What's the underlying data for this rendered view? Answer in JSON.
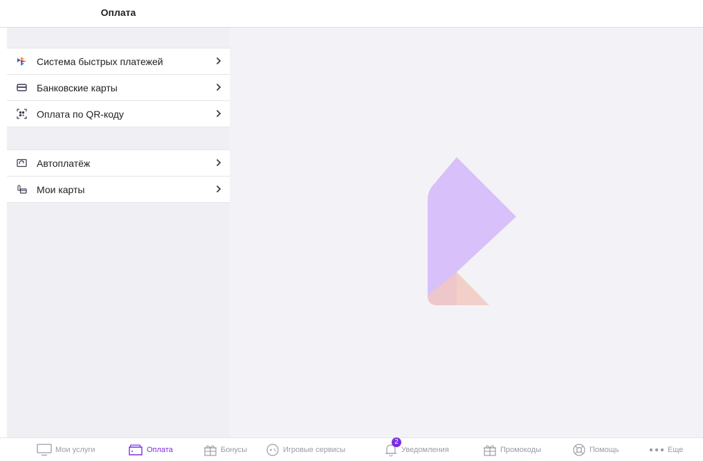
{
  "header": {
    "title": "Оплата"
  },
  "sidebar": {
    "group1": [
      {
        "label": "Система быстрых платежей",
        "icon": "sbp-icon"
      },
      {
        "label": "Банковские карты",
        "icon": "bank-card-icon"
      },
      {
        "label": "Оплата по QR-коду",
        "icon": "qr-code-icon"
      }
    ],
    "group2": [
      {
        "label": "Автоплатёж",
        "icon": "autopay-icon"
      },
      {
        "label": "Мои карты",
        "icon": "my-cards-icon"
      }
    ]
  },
  "tabbar": {
    "items": [
      {
        "label": "Мои услуги",
        "icon": "monitor-icon"
      },
      {
        "label": "Оплата",
        "icon": "wallet-icon",
        "active": true
      },
      {
        "label": "Бонусы",
        "icon": "gift-icon"
      },
      {
        "label": "Игровые сервисы",
        "icon": "gamepad-icon"
      },
      {
        "label": "Уведомления",
        "icon": "bell-icon",
        "badge": "2"
      },
      {
        "label": "Промокоды",
        "icon": "promo-gift-icon"
      },
      {
        "label": "Помощь",
        "icon": "lifebuoy-icon"
      },
      {
        "label": "Еще",
        "icon": "more-dots-icon"
      }
    ]
  },
  "colors": {
    "accent": "#7a2fe0",
    "logo_violet": "#d8c0fa",
    "logo_peach": "#f1c8bf"
  }
}
